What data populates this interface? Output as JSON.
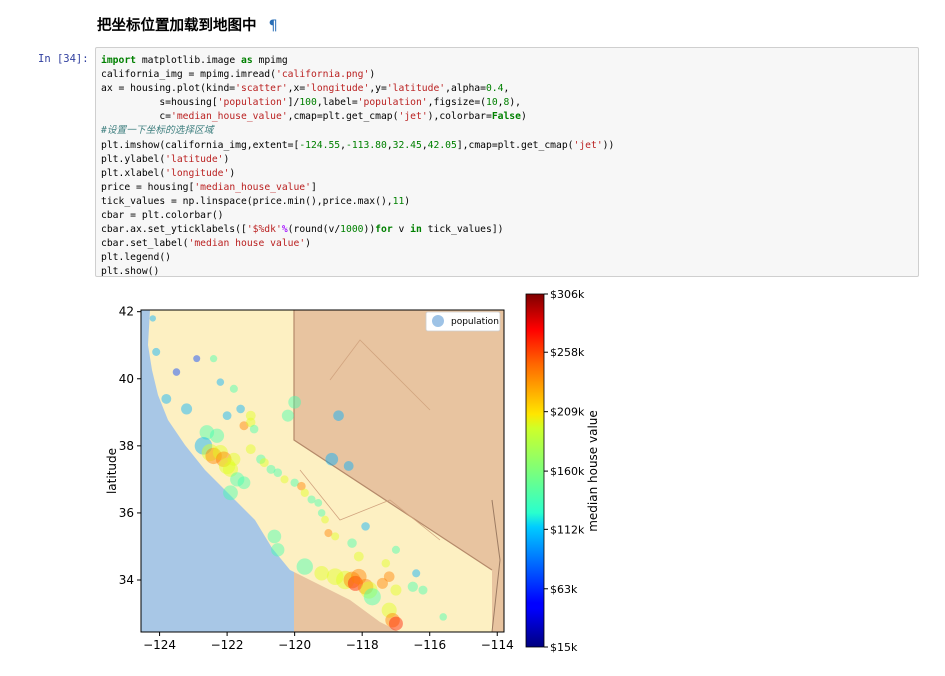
{
  "notebook": {
    "heading": "把坐标位置加载到地图中",
    "pilcrow": "¶",
    "prompt": "In [34]:",
    "code_lines": [
      [
        [
          "kw",
          "import"
        ],
        [
          "t",
          " matplotlib.image "
        ],
        [
          "kw",
          "as"
        ],
        [
          "t",
          " mpimg"
        ]
      ],
      [
        [
          "t",
          "california_img = mpimg.imread("
        ],
        [
          "str",
          "'california.png'"
        ],
        [
          "t",
          ")"
        ]
      ],
      [
        [
          "t",
          "ax = housing.plot(kind="
        ],
        [
          "str",
          "'scatter'"
        ],
        [
          "t",
          ",x="
        ],
        [
          "str",
          "'longitude'"
        ],
        [
          "t",
          ",y="
        ],
        [
          "str",
          "'latitude'"
        ],
        [
          "t",
          ",alpha="
        ],
        [
          "num",
          "0.4"
        ],
        [
          "t",
          ","
        ]
      ],
      [
        [
          "t",
          "          s=housing["
        ],
        [
          "str",
          "'population'"
        ],
        [
          "t",
          "]/"
        ],
        [
          "num",
          "100"
        ],
        [
          "t",
          ",label="
        ],
        [
          "str",
          "'population'"
        ],
        [
          "t",
          ",figsize=("
        ],
        [
          "num",
          "10"
        ],
        [
          "t",
          ","
        ],
        [
          "num",
          "8"
        ],
        [
          "t",
          "),"
        ]
      ],
      [
        [
          "t",
          "          c="
        ],
        [
          "str",
          "'median_house_value'"
        ],
        [
          "t",
          ",cmap=plt.get_cmap("
        ],
        [
          "str",
          "'jet'"
        ],
        [
          "t",
          "),colorbar="
        ],
        [
          "kw",
          "False"
        ],
        [
          "t",
          ")"
        ]
      ],
      [
        [
          "cm",
          "#设置一下坐标的选择区域"
        ]
      ],
      [
        [
          "t",
          "plt.imshow(california_img,extent=["
        ],
        [
          "num",
          "-124.55"
        ],
        [
          "t",
          ","
        ],
        [
          "num",
          "-113.80"
        ],
        [
          "t",
          ","
        ],
        [
          "num",
          "32.45"
        ],
        [
          "t",
          ","
        ],
        [
          "num",
          "42.05"
        ],
        [
          "t",
          "],cmap=plt.get_cmap("
        ],
        [
          "str",
          "'jet'"
        ],
        [
          "t",
          "))"
        ]
      ],
      [
        [
          "t",
          "plt.ylabel("
        ],
        [
          "str",
          "'latitude'"
        ],
        [
          "t",
          ")"
        ]
      ],
      [
        [
          "t",
          "plt.xlabel("
        ],
        [
          "str",
          "'longitude'"
        ],
        [
          "t",
          ")"
        ]
      ],
      [
        [
          "t",
          "price = housing["
        ],
        [
          "str",
          "'median_house_value'"
        ],
        [
          "t",
          "]"
        ]
      ],
      [
        [
          "t",
          "tick_values = np.linspace(price.min(),price.max(),"
        ],
        [
          "num",
          "11"
        ],
        [
          "t",
          ")"
        ]
      ],
      [
        [
          "t",
          "cbar = plt.colorbar()"
        ]
      ],
      [
        [
          "t",
          "cbar.ax.set_yticklabels(["
        ],
        [
          "str",
          "'$%dk'"
        ],
        [
          "op",
          "%"
        ],
        [
          "t",
          "(round(v/"
        ],
        [
          "num",
          "1000"
        ],
        [
          "t",
          "))"
        ],
        [
          "kw",
          "for"
        ],
        [
          "t",
          " v "
        ],
        [
          "kw",
          "in"
        ],
        [
          "t",
          " tick_values])"
        ]
      ],
      [
        [
          "t",
          "cbar.set_label("
        ],
        [
          "str",
          "'median house value'"
        ],
        [
          "t",
          ")"
        ]
      ],
      [
        [
          "t",
          "plt.legend()"
        ]
      ],
      [
        [
          "t",
          "plt.show()"
        ]
      ]
    ]
  },
  "chart_data": {
    "type": "scatter",
    "title": "",
    "xlabel": "",
    "ylabel": "latitude",
    "x_ticks": [
      "−124",
      "−122",
      "−120",
      "−118",
      "−116",
      "−114"
    ],
    "y_ticks": [
      "34",
      "36",
      "38",
      "40",
      "42"
    ],
    "xlim": [
      -124.55,
      -113.8
    ],
    "ylim": [
      32.45,
      42.05
    ],
    "legend": {
      "label": "population",
      "placement": "top-right",
      "marker_color": "#9ec3e6"
    },
    "colorbar": {
      "label": "median house value",
      "cmap": "jet",
      "tick_labels": [
        "$15k",
        "$63k",
        "$112k",
        "$160k",
        "$209k",
        "$258k",
        "$306k"
      ],
      "range": [
        15,
        306
      ]
    },
    "series": [
      {
        "label": "population",
        "points": [
          [
            -124.2,
            41.8,
            50,
            2
          ],
          [
            -124.1,
            40.8,
            80,
            2
          ],
          [
            -123.8,
            39.4,
            120,
            2
          ],
          [
            -123.5,
            40.2,
            70,
            1
          ],
          [
            -122.9,
            40.6,
            60,
            1
          ],
          [
            -122.4,
            40.6,
            65,
            3
          ],
          [
            -122.2,
            39.9,
            70,
            2
          ],
          [
            -121.8,
            39.7,
            80,
            3
          ],
          [
            -121.6,
            39.1,
            90,
            2
          ],
          [
            -121.3,
            38.9,
            120,
            4
          ],
          [
            -121.5,
            38.6,
            100,
            5
          ],
          [
            -121.3,
            38.7,
            110,
            4
          ],
          [
            -121.2,
            38.5,
            90,
            3
          ],
          [
            -122.0,
            38.9,
            95,
            2
          ],
          [
            -122.3,
            38.3,
            250,
            3
          ],
          [
            -122.6,
            38.4,
            260,
            3
          ],
          [
            -122.7,
            38.0,
            380,
            2
          ],
          [
            -122.5,
            37.8,
            360,
            4
          ],
          [
            -122.4,
            37.7,
            330,
            5
          ],
          [
            -122.2,
            37.8,
            280,
            4
          ],
          [
            -122.1,
            37.6,
            300,
            5
          ],
          [
            -122.0,
            37.4,
            330,
            4
          ],
          [
            -121.9,
            37.3,
            280,
            4
          ],
          [
            -121.7,
            37.0,
            250,
            3
          ],
          [
            -121.9,
            36.6,
            270,
            3
          ],
          [
            -121.5,
            36.9,
            200,
            3
          ],
          [
            -121.8,
            37.6,
            210,
            4
          ],
          [
            -121.3,
            37.9,
            120,
            4
          ],
          [
            -121.0,
            37.6,
            110,
            3
          ],
          [
            -120.9,
            37.5,
            100,
            4
          ],
          [
            -120.7,
            37.3,
            100,
            3
          ],
          [
            -120.5,
            37.2,
            90,
            3
          ],
          [
            -120.3,
            37.0,
            80,
            4
          ],
          [
            -120.0,
            36.9,
            85,
            3
          ],
          [
            -119.8,
            36.8,
            90,
            5
          ],
          [
            -119.7,
            36.6,
            85,
            4
          ],
          [
            -119.5,
            36.4,
            80,
            3
          ],
          [
            -119.3,
            36.3,
            75,
            3
          ],
          [
            -119.2,
            36.0,
            70,
            3
          ],
          [
            -119.1,
            35.8,
            75,
            4
          ],
          [
            -119.0,
            35.4,
            80,
            5
          ],
          [
            -118.8,
            35.3,
            80,
            4
          ],
          [
            -120.6,
            35.3,
            230,
            3
          ],
          [
            -120.5,
            34.9,
            220,
            3
          ],
          [
            -119.7,
            34.4,
            330,
            3
          ],
          [
            -119.2,
            34.2,
            260,
            4
          ],
          [
            -118.8,
            34.1,
            340,
            4
          ],
          [
            -118.5,
            34.0,
            420,
            4
          ],
          [
            -118.3,
            34.0,
            350,
            5
          ],
          [
            -118.2,
            33.9,
            280,
            6
          ],
          [
            -118.1,
            34.1,
            300,
            5
          ],
          [
            -117.9,
            33.8,
            300,
            5
          ],
          [
            -117.8,
            33.7,
            360,
            4
          ],
          [
            -117.7,
            33.5,
            360,
            3
          ],
          [
            -117.4,
            33.9,
            150,
            5
          ],
          [
            -117.2,
            34.1,
            140,
            5
          ],
          [
            -117.0,
            33.7,
            150,
            4
          ],
          [
            -117.2,
            33.1,
            280,
            4
          ],
          [
            -117.1,
            32.8,
            260,
            5
          ],
          [
            -117.0,
            32.7,
            240,
            6
          ],
          [
            -116.5,
            33.8,
            130,
            3
          ],
          [
            -116.2,
            33.7,
            100,
            3
          ],
          [
            -115.6,
            32.9,
            70,
            3
          ],
          [
            -117.3,
            34.5,
            90,
            4
          ],
          [
            -117.0,
            34.9,
            80,
            3
          ],
          [
            -116.4,
            34.2,
            80,
            2
          ],
          [
            -118.1,
            34.7,
            120,
            4
          ],
          [
            -118.3,
            35.1,
            110,
            3
          ],
          [
            -117.9,
            35.6,
            90,
            2
          ],
          [
            -118.9,
            37.6,
            200,
            2
          ],
          [
            -118.4,
            37.4,
            120,
            2
          ],
          [
            -118.7,
            38.9,
            140,
            2
          ],
          [
            -120.0,
            39.3,
            200,
            3
          ],
          [
            -120.2,
            38.9,
            180,
            3
          ],
          [
            -123.2,
            39.1,
            150,
            2
          ]
        ]
      }
    ]
  }
}
